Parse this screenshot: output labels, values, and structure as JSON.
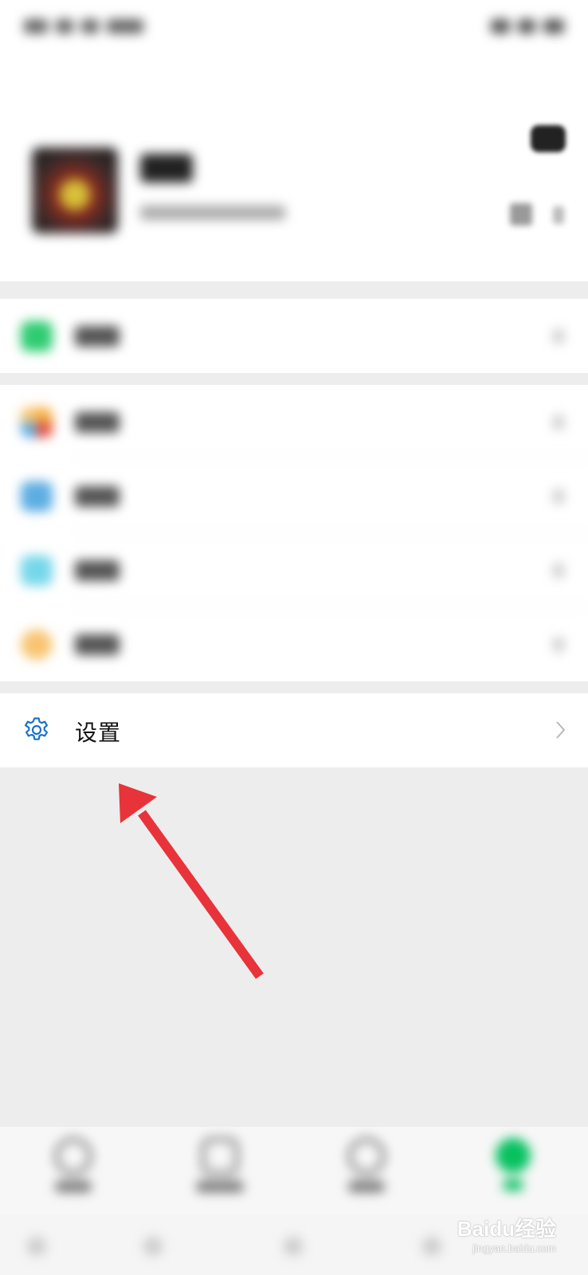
{
  "status_bar": {},
  "profile": {
    "name": "",
    "subtitle": ""
  },
  "group_pay": {
    "items": [
      {
        "label": "",
        "icon": "pay-icon",
        "color": "#2ecc71"
      }
    ]
  },
  "group_features": {
    "items": [
      {
        "label": "",
        "icon": "favorites-icon",
        "color": "#f5b041"
      },
      {
        "label": "",
        "icon": "moments-icon",
        "color": "#5dade2"
      },
      {
        "label": "",
        "icon": "cards-icon",
        "color": "#76d7ea"
      },
      {
        "label": "",
        "icon": "stickers-icon",
        "color": "#f8c471"
      }
    ]
  },
  "settings": {
    "label": "设置",
    "icon": "gear-icon",
    "accent": "#1a73c9"
  },
  "annotation": {
    "arrow_color": "#e8333a"
  },
  "bottom_nav": {
    "items": [
      {
        "label": "",
        "icon": "chats-icon"
      },
      {
        "label": "",
        "icon": "contacts-icon"
      },
      {
        "label": "",
        "icon": "discover-icon"
      },
      {
        "label": "",
        "icon": "me-icon",
        "active_color": "#07c160"
      }
    ]
  },
  "watermark": {
    "brand": "Baidu经验",
    "url": "jingyan.baidu.com"
  }
}
